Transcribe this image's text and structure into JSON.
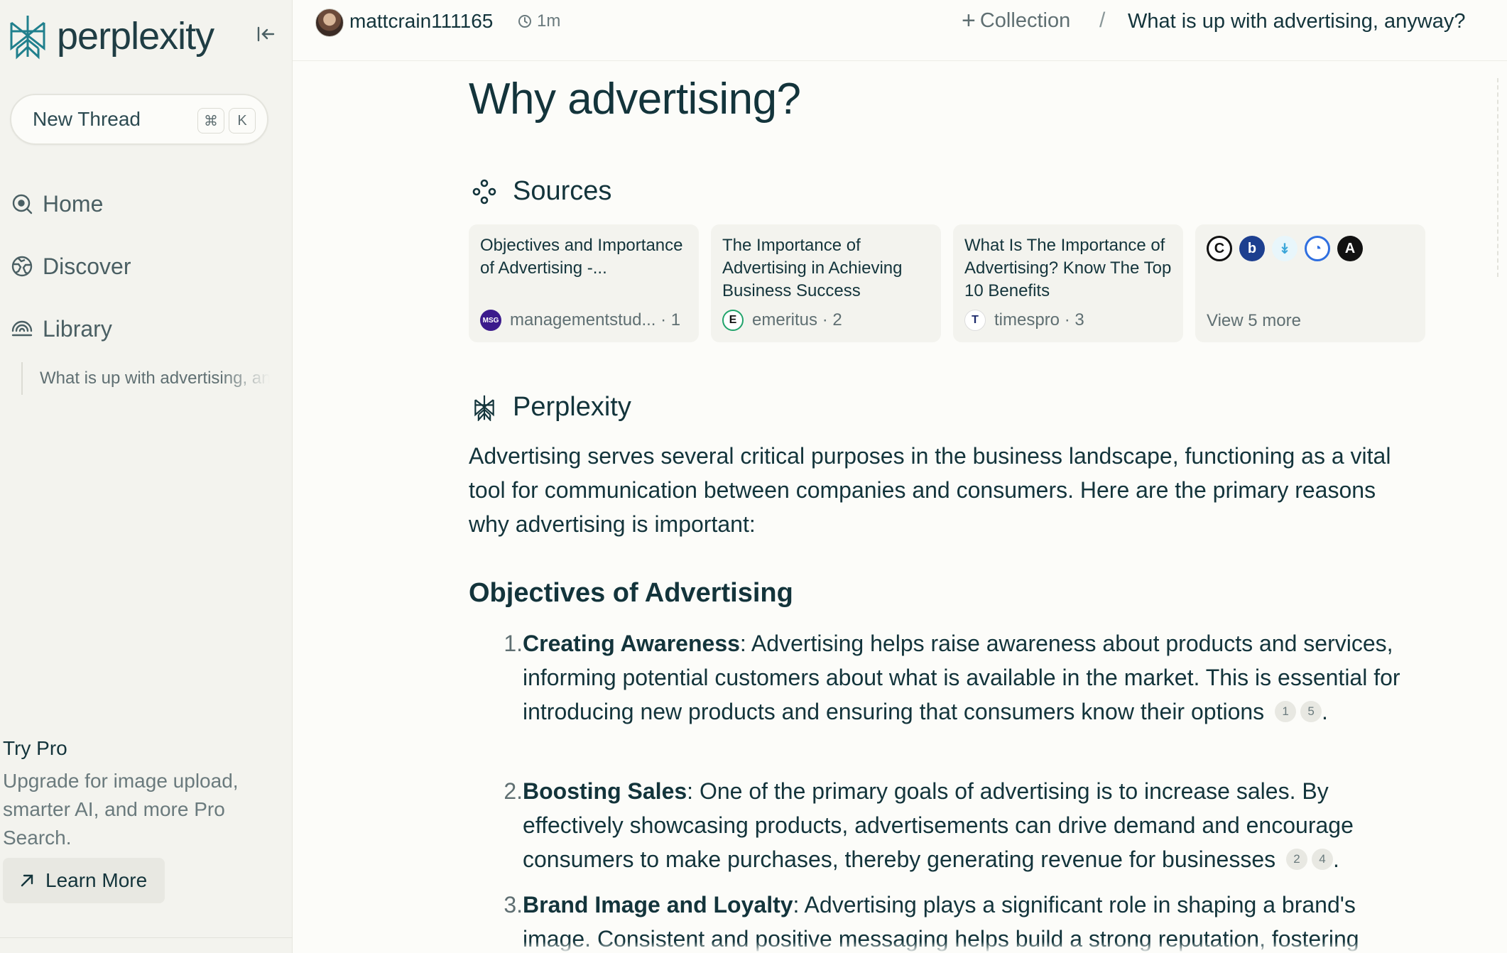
{
  "sidebar": {
    "logo_text": "perplexity",
    "new_thread_label": "New Thread",
    "shortcut_cmd": "⌘",
    "shortcut_key": "K",
    "nav": [
      {
        "label": "Home",
        "icon": "home-search-icon"
      },
      {
        "label": "Discover",
        "icon": "globe-icon"
      },
      {
        "label": "Library",
        "icon": "library-icon"
      }
    ],
    "library_thread": "What is up with advertising, anyway?",
    "try_pro_title": "Try Pro",
    "try_pro_desc": "Upgrade for image upload, smarter AI, and more Pro Search.",
    "learn_more_label": "Learn More"
  },
  "topbar": {
    "username": "mattcrain111165",
    "time": "1m",
    "collection_label": "Collection",
    "separator": "/",
    "thread_title": "What is up with advertising, anyway?"
  },
  "main": {
    "title": "Why advertising?",
    "sources_label": "Sources",
    "sources": [
      {
        "title": "Objectives and Importance of Advertising -...",
        "domain": "managementstud... · 1",
        "favicon": "MSG"
      },
      {
        "title": "The Importance of Advertising in Achieving Business Success",
        "domain": "emeritus · 2",
        "favicon": "E"
      },
      {
        "title": "What Is The Importance of Advertising? Know The Top 10 Benefits",
        "domain": "timespro · 3",
        "favicon": "T"
      }
    ],
    "more_favicons": [
      "C",
      "b",
      "↡",
      "◔",
      "A"
    ],
    "view_more_label": "View 5 more",
    "answer_label": "Perplexity",
    "intro": "Advertising serves several critical purposes in the business landscape, functioning as a vital tool for communication between companies and consumers. Here are the primary reasons why advertising is important:",
    "subhead": "Objectives of Advertising",
    "items": [
      {
        "num": "1.",
        "bold": "Creating Awareness",
        "text": ": Advertising helps raise awareness about products and services, informing potential customers about what is available in the market. This is essential for introducing new products and ensuring that consumers know their options",
        "cites": [
          "1",
          "5"
        ],
        "end": "."
      },
      {
        "num": "2.",
        "bold": "Boosting Sales",
        "text": ": One of the primary goals of advertising is to increase sales. By effectively showcasing products, advertisements can drive demand and encourage consumers to make purchases, thereby generating revenue for businesses",
        "cites": [
          "2",
          "4"
        ],
        "end": "."
      },
      {
        "num": "3.",
        "bold": "Brand Image and Loyalty",
        "text": ": Advertising plays a significant role in shaping a brand's image. Consistent and positive messaging helps build a strong reputation, fostering"
      }
    ]
  },
  "colors": {
    "background": "#fcfcf9",
    "sidebar": "#f3f3ee",
    "text": "#13343b",
    "muted": "#5f6f72",
    "accent": "#20808d"
  }
}
